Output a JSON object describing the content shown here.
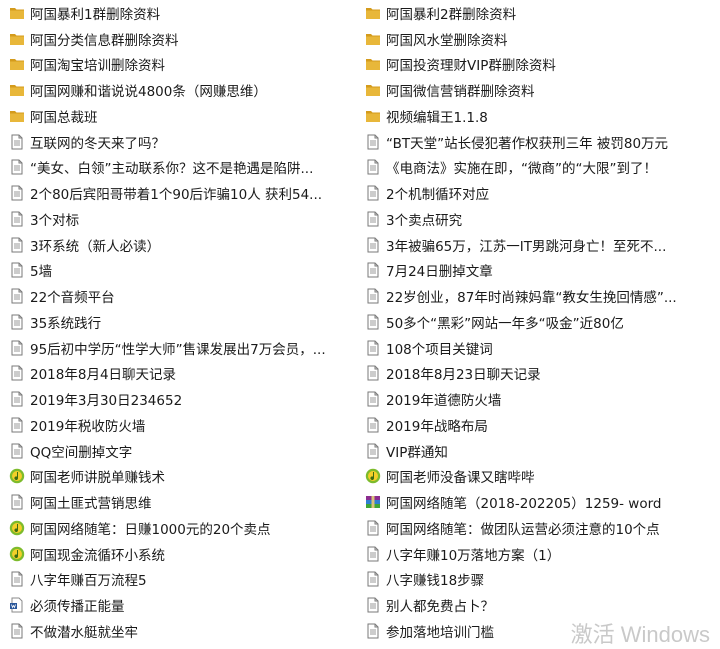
{
  "left_column": [
    {
      "icon": "folder-icon",
      "label": "阿国暴利1群删除资料"
    },
    {
      "icon": "folder-icon",
      "label": "阿国分类信息群删除资料"
    },
    {
      "icon": "folder-icon",
      "label": "阿国淘宝培训删除资料"
    },
    {
      "icon": "folder-icon",
      "label": "阿国网赚和谐说说4800条（网赚思维）"
    },
    {
      "icon": "folder-icon",
      "label": "阿国总裁班"
    },
    {
      "icon": "document-icon",
      "label": "互联网的冬天来了吗？"
    },
    {
      "icon": "document-icon",
      "label": "“美女、白领”主动联系你？这不是艳遇是陷阱..."
    },
    {
      "icon": "document-icon",
      "label": "2个80后宾阳哥带着1个90后诈骗10人 获利54..."
    },
    {
      "icon": "document-icon",
      "label": "3个对标"
    },
    {
      "icon": "document-icon",
      "label": "3环系统（新人必读）"
    },
    {
      "icon": "document-icon",
      "label": "5墙"
    },
    {
      "icon": "document-icon",
      "label": "22个音频平台"
    },
    {
      "icon": "document-icon",
      "label": "35系统践行"
    },
    {
      "icon": "document-icon",
      "label": "95后初中学历“性学大师”售课发展出7万会员，..."
    },
    {
      "icon": "document-icon",
      "label": "2018年8月4日聊天记录"
    },
    {
      "icon": "document-icon",
      "label": "2019年3月30日234652"
    },
    {
      "icon": "document-icon",
      "label": "2019年税收防火墙"
    },
    {
      "icon": "document-icon",
      "label": "QQ空间删掉文字"
    },
    {
      "icon": "audio-file-icon",
      "label": "阿国老师讲脱单赚钱术"
    },
    {
      "icon": "document-icon",
      "label": "阿国土匪式营销思维"
    },
    {
      "icon": "audio-file-icon",
      "label": "阿国网络随笔：日赚1000元的20个卖点"
    },
    {
      "icon": "audio-file-icon",
      "label": "阿国现金流循环小系统"
    },
    {
      "icon": "document-icon",
      "label": "八字年赚百万流程5"
    },
    {
      "icon": "word-document-icon",
      "label": "必须传播正能量"
    },
    {
      "icon": "document-icon",
      "label": "不做潜水艇就坐牢"
    }
  ],
  "right_column": [
    {
      "icon": "folder-icon",
      "label": "阿国暴利2群删除资料"
    },
    {
      "icon": "folder-icon",
      "label": "阿国风水堂删除资料"
    },
    {
      "icon": "folder-icon",
      "label": "阿国投资理财VIP群删除资料"
    },
    {
      "icon": "folder-icon",
      "label": "阿国微信营销群删除资料"
    },
    {
      "icon": "folder-icon",
      "label": "视频编辑王1.1.8"
    },
    {
      "icon": "document-icon",
      "label": "“BT天堂”站长侵犯著作权获刑三年 被罚80万元"
    },
    {
      "icon": "document-icon",
      "label": "《电商法》实施在即，“微商”的“大限”到了！"
    },
    {
      "icon": "document-icon",
      "label": "2个机制循环对应"
    },
    {
      "icon": "document-icon",
      "label": "3个卖点研究"
    },
    {
      "icon": "document-icon",
      "label": "3年被骗65万，江苏一IT男跳河身亡！至死不..."
    },
    {
      "icon": "document-icon",
      "label": "7月24日删掉文章"
    },
    {
      "icon": "document-icon",
      "label": "22岁创业，87年时尚辣妈靠“教女生挽回情感”..."
    },
    {
      "icon": "document-icon",
      "label": "50多个“黑彩”网站一年多“吸金”近80亿"
    },
    {
      "icon": "document-icon",
      "label": "108个项目关键词"
    },
    {
      "icon": "document-icon",
      "label": "2018年8月23日聊天记录"
    },
    {
      "icon": "document-icon",
      "label": "2019年道德防火墙"
    },
    {
      "icon": "document-icon",
      "label": "2019年战略布局"
    },
    {
      "icon": "document-icon",
      "label": "VIP群通知"
    },
    {
      "icon": "audio-file-icon",
      "label": "阿国老师没备课又瞎哔哔"
    },
    {
      "icon": "archive-icon",
      "label": "阿国网络随笔（2018-202205）1259- word"
    },
    {
      "icon": "document-icon",
      "label": "阿国网络随笔：做团队运营必须注意的10个点"
    },
    {
      "icon": "document-icon",
      "label": "八字年赚10万落地方案（1）"
    },
    {
      "icon": "document-icon",
      "label": "八字赚钱18步骤"
    },
    {
      "icon": "document-icon",
      "label": "别人都免费占卜？"
    },
    {
      "icon": "document-icon",
      "label": "参加落地培训门槛"
    }
  ],
  "watermark": "激活 Windows",
  "colors": {
    "folder": "#e8b73a",
    "folder_dark": "#d49b1c",
    "doc_border": "#7a7a7a",
    "audio_green": "#7dbb2c",
    "audio_yellow": "#f3cf29",
    "word_blue": "#2b579a"
  }
}
